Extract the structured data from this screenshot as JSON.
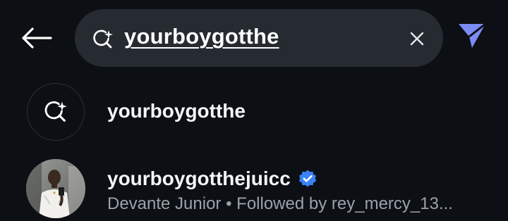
{
  "header": {
    "back_icon": "arrow-left-icon",
    "search": {
      "icon": "ai-search-sparkle-icon",
      "value": "yourboygotthe",
      "clear_icon": "close-icon"
    },
    "send_icon": "send-arrow-icon",
    "send_color": "#7c8cf5"
  },
  "results": {
    "suggestion": {
      "icon": "ai-search-sparkle-icon",
      "text": "yourboygotthe"
    },
    "user": {
      "avatar": "profile-photo",
      "username": "yourboygotthejuicc",
      "verified_icon": "verified-badge-icon",
      "verified_color": "#3b82f6",
      "subtitle": "Devante Junior • Followed by rey_mercy_13..."
    }
  }
}
